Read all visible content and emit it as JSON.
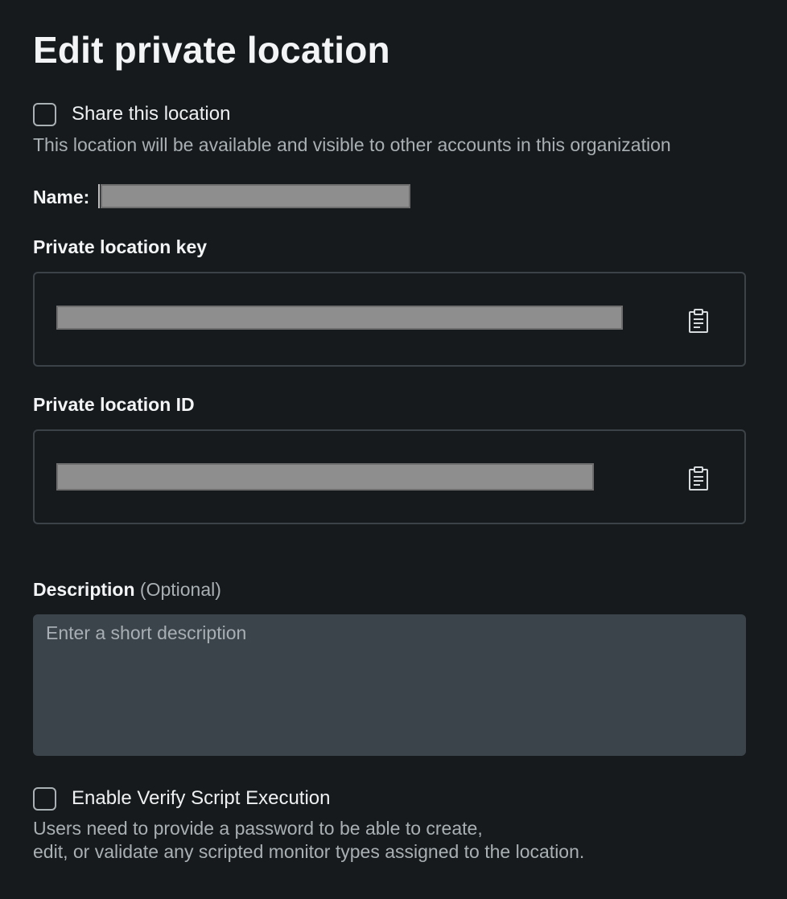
{
  "title": "Edit private location",
  "share": {
    "label": "Share this location",
    "help": "This location will be available and visible to other accounts in this organization"
  },
  "name": {
    "label": "Name:"
  },
  "key": {
    "label": "Private location key",
    "copy_icon": "clipboard-icon"
  },
  "id": {
    "label": "Private location ID",
    "copy_icon": "clipboard-icon"
  },
  "description": {
    "label": "Description",
    "optional": "(Optional)",
    "placeholder": "Enter a short description",
    "value": ""
  },
  "verify": {
    "label": "Enable Verify Script Execution",
    "help_line1": "Users need to provide a password to be able to create,",
    "help_line2": "edit, or validate any scripted monitor types assigned to the location."
  },
  "colors": {
    "background": "#161a1d",
    "text": "#eef0f1",
    "muted_text": "#a9b0b4",
    "field_border": "#3c4348",
    "textarea_bg": "#3c444b",
    "redaction": "#8e8e8e"
  }
}
